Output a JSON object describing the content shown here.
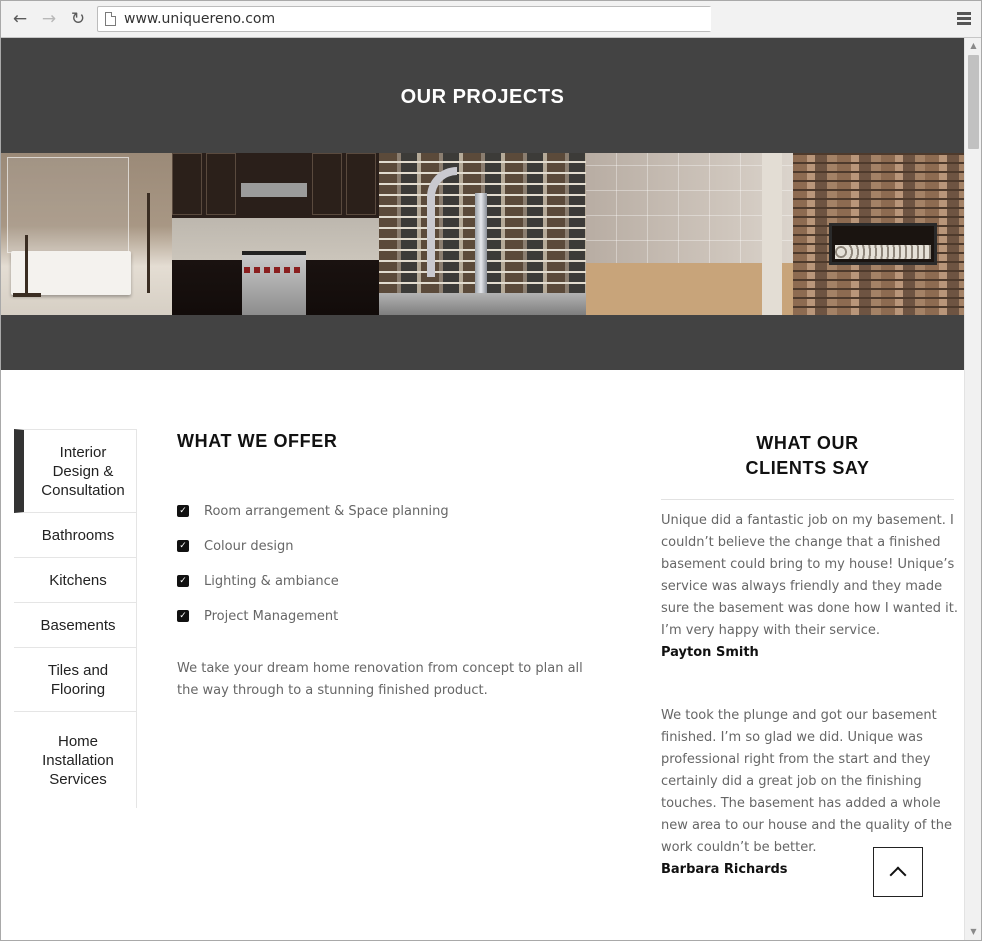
{
  "browser": {
    "url": "www.uniquereno.com"
  },
  "projects": {
    "title": "OUR PROJECTS",
    "photos": [
      "bathroom-photo",
      "kitchen-photo",
      "faucet-backsplash-photo",
      "tiled-shower-photo",
      "stone-fireplace-photo"
    ]
  },
  "tabs": [
    {
      "label": "Interior Design & Consultation",
      "active": true
    },
    {
      "label": "Bathrooms",
      "active": false
    },
    {
      "label": "Kitchens",
      "active": false
    },
    {
      "label": "Basements",
      "active": false
    },
    {
      "label": "Tiles and Flooring",
      "active": false
    },
    {
      "label": "Home Installation Services",
      "active": false
    }
  ],
  "offer": {
    "title": "WHAT WE OFFER",
    "items": [
      "Room arrangement & Space planning",
      "Colour design",
      "Lighting & ambiance",
      "Project Management"
    ],
    "description": "We take your dream home renovation from concept to plan all the way through to a stunning finished product."
  },
  "clients": {
    "title_line1": "WHAT OUR",
    "title_line2": "CLIENTS SAY",
    "testimonials": [
      {
        "text": "Unique did a fantastic job on my basement. I couldn’t believe the change that a finished basement could bring to my house! Unique’s service was always friendly and they made sure the basement was done how I wanted it. I’m very happy with their service.",
        "author": "Payton Smith"
      },
      {
        "text": "We took the plunge and got our basement finished. I’m so glad we did. Unique was professional right from the start and they certainly did a great job on the finishing touches. The basement has added a whole new area to our house and the quality of the work couldn’t be better.",
        "author": "Barbara Richards"
      }
    ]
  }
}
